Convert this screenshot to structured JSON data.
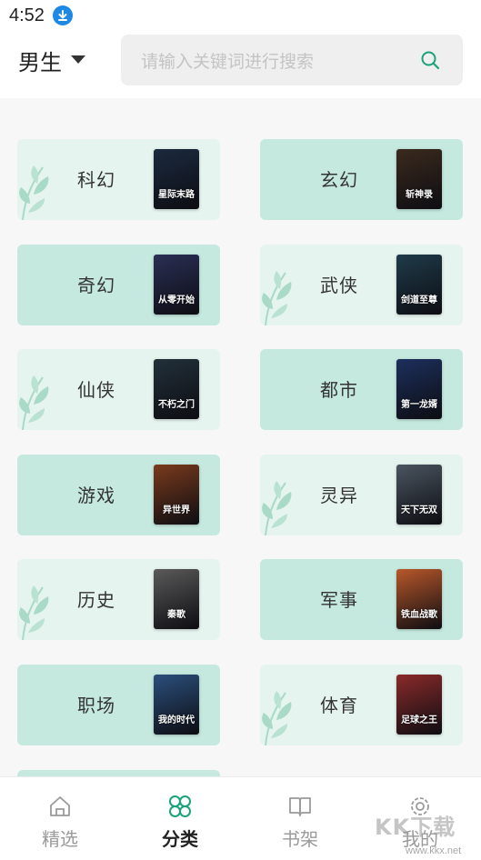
{
  "status_bar": {
    "time": "4:52",
    "download_icon": "download-arrow-icon"
  },
  "header": {
    "gender_label": "男生",
    "gender_dropdown_icon": "caret-down-icon",
    "search_placeholder": "请输入关键词进行搜索",
    "search_icon": "search-icon"
  },
  "categories": [
    {
      "label": "科幻",
      "cover_title": "星际末路",
      "leaf": true,
      "tone": "light"
    },
    {
      "label": "玄幻",
      "cover_title": "斩神录",
      "leaf": false,
      "tone": "dark"
    },
    {
      "label": "奇幻",
      "cover_title": "从零开始",
      "leaf": false,
      "tone": "dark"
    },
    {
      "label": "武侠",
      "cover_title": "剑道至尊",
      "leaf": true,
      "tone": "light"
    },
    {
      "label": "仙侠",
      "cover_title": "不朽之门",
      "leaf": true,
      "tone": "light"
    },
    {
      "label": "都市",
      "cover_title": "第一龙婿",
      "leaf": false,
      "tone": "dark"
    },
    {
      "label": "游戏",
      "cover_title": "异世界",
      "leaf": false,
      "tone": "dark"
    },
    {
      "label": "灵异",
      "cover_title": "天下无双",
      "leaf": true,
      "tone": "light"
    },
    {
      "label": "历史",
      "cover_title": "秦歌",
      "leaf": true,
      "tone": "light"
    },
    {
      "label": "军事",
      "cover_title": "铁血战歌",
      "leaf": false,
      "tone": "dark"
    },
    {
      "label": "职场",
      "cover_title": "我的时代",
      "leaf": false,
      "tone": "dark"
    },
    {
      "label": "体育",
      "cover_title": "足球之王",
      "leaf": true,
      "tone": "light"
    }
  ],
  "cover_colors": [
    "#1b2a3f",
    "#3b2a1e",
    "#2a2f55",
    "#1f3b4a",
    "#22303a",
    "#1c2f5c",
    "#7a3a1d",
    "#4a5560",
    "#5a5a5a",
    "#b8572a",
    "#2b4f7c",
    "#8a2a2a"
  ],
  "nav": [
    {
      "label": "精选",
      "icon": "home-icon",
      "active": false
    },
    {
      "label": "分类",
      "icon": "category-clover-icon",
      "active": true
    },
    {
      "label": "书架",
      "icon": "book-open-icon",
      "active": false
    },
    {
      "label": "我的",
      "icon": "profile-gear-icon",
      "active": false
    }
  ],
  "watermark": {
    "text": "KK下载",
    "url": "www.kkx.net"
  },
  "colors": {
    "accent": "#1aa37a",
    "card_dark": "#c5e9df",
    "card_light": "#e6f4ef"
  }
}
